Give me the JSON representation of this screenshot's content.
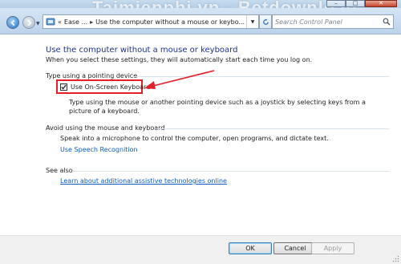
{
  "window": {
    "watermark": "Taimienphi.vn - Betdownload",
    "buttons": {
      "minimize": "–",
      "maximize": "□",
      "close": "✕"
    }
  },
  "nav": {
    "breadcrumbs": [
      "Ease ...",
      "Use the computer without a mouse or keybo..."
    ],
    "search_placeholder": "Search Control Panel"
  },
  "main": {
    "title": "Use the computer without a mouse or keyboard",
    "subtitle": "When you select these settings, they will automatically start each time you log on.",
    "pointing_section": {
      "label": "Type using a pointing device",
      "checkbox_label": "Use On-Screen Keyboard",
      "checkbox_checked": true,
      "description": "Type using the mouse or another pointing device such as a joystick by selecting keys from a picture of a keyboard."
    },
    "speech_section": {
      "label": "Avoid using the mouse and keyboard",
      "description": "Speak into a microphone to control the computer, open programs, and dictate text.",
      "link": "Use Speech Recognition"
    },
    "see_also": {
      "label": "See also",
      "link": "Learn about additional assistive technologies online"
    },
    "annotation_color": "#e4202a",
    "link_color": "#0a5bc4",
    "title_color": "#1e3287"
  },
  "footer": {
    "ok": "OK",
    "cancel": "Cancel",
    "apply": "Apply"
  }
}
